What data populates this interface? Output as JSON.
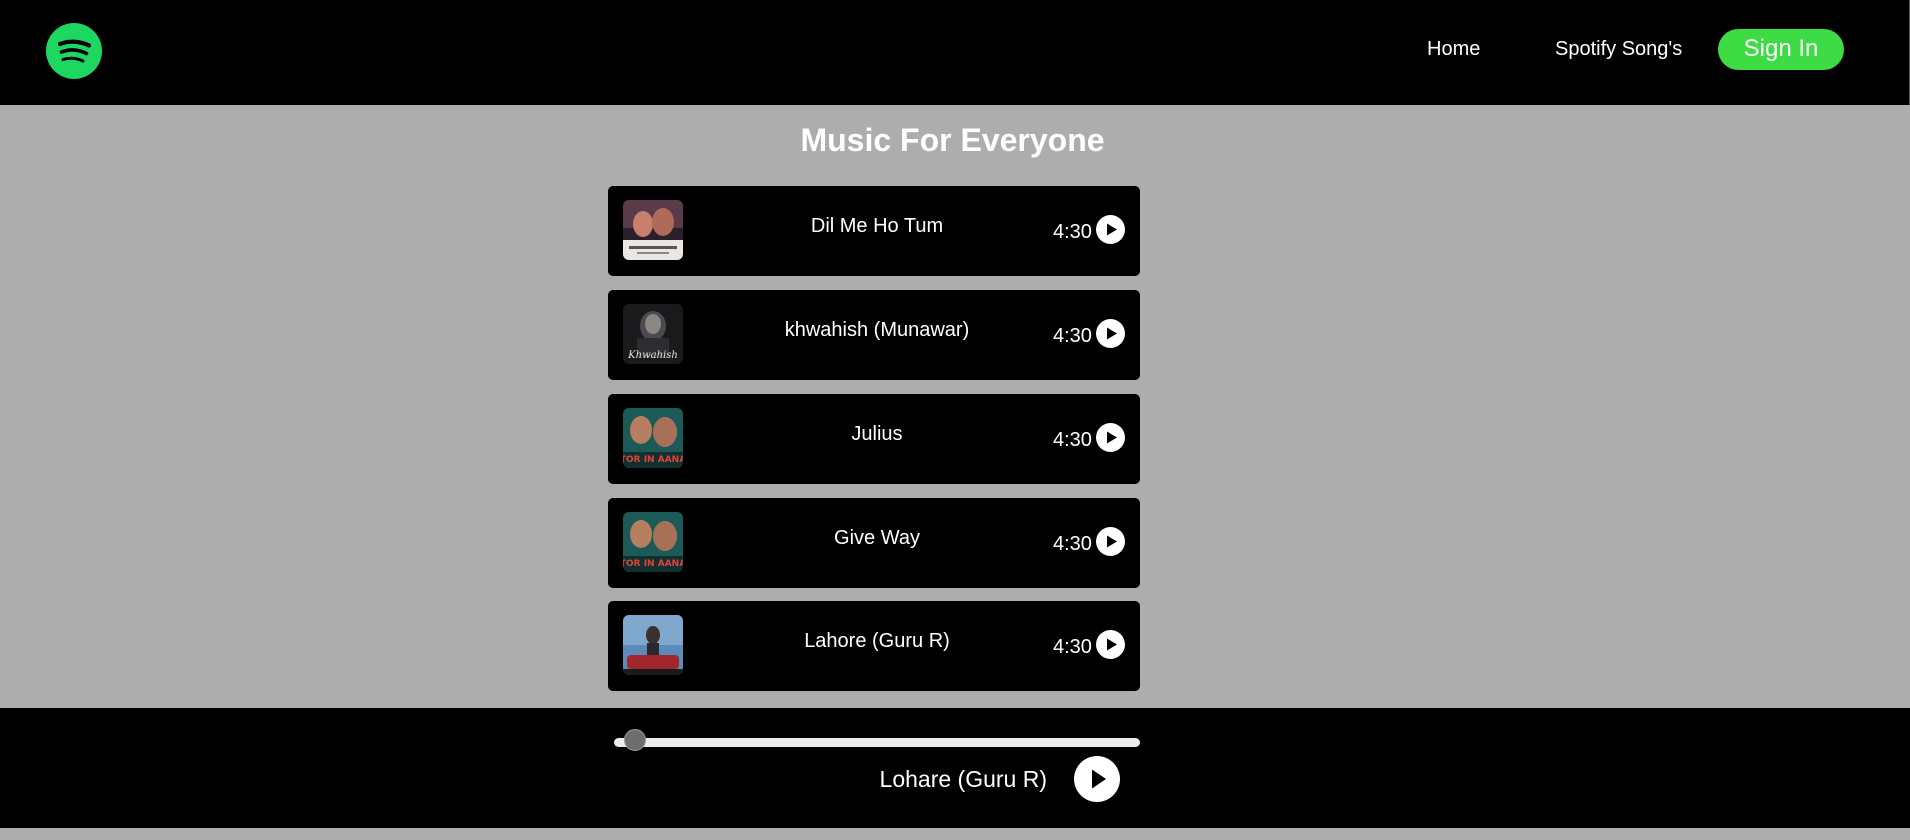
{
  "brand": {
    "logo_icon": "spotify-logo-icon",
    "accent": "#1ed760"
  },
  "nav": {
    "home_label": "Home",
    "songs_label": "Spotify Song's",
    "signin_label": "Sign In",
    "signin_color": "#3ddc45"
  },
  "main": {
    "title": "Music For Everyone",
    "songs": [
      {
        "title": "Dil Me Ho Tum",
        "duration": "4:30",
        "cover_icon": "album-cover",
        "play_icon": "play-icon"
      },
      {
        "title": "khwahish (Munawar)",
        "duration": "4:30",
        "cover_icon": "album-cover",
        "play_icon": "play-icon"
      },
      {
        "title": "Julius",
        "duration": "4:30",
        "cover_icon": "album-cover",
        "play_icon": "play-icon"
      },
      {
        "title": "Give Way",
        "duration": "4:30",
        "cover_icon": "album-cover",
        "play_icon": "play-icon"
      },
      {
        "title": "Lahore (Guru R)",
        "duration": "4:30",
        "cover_icon": "album-cover",
        "play_icon": "play-icon"
      }
    ]
  },
  "player": {
    "now_playing": "Lohare (Guru R)",
    "progress": 0.02,
    "play_icon": "play-icon"
  }
}
